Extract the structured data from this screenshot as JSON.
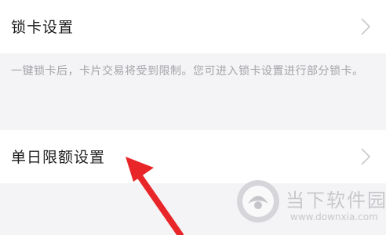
{
  "lock_card": {
    "label": "锁卡设置",
    "description": "一键锁卡后，卡片交易将受到限制。您可进入锁卡设置进行部分锁卡。"
  },
  "single_day_limit": {
    "label": "单日限额设置"
  },
  "watermark": {
    "title": "当下软件园",
    "url": "www.downxia.com"
  },
  "colors": {
    "background": "#f4f4f6",
    "row": "#ffffff",
    "arrow": "#e8262a",
    "description": "#a5a5aa"
  },
  "icons": [
    "chevron-right-icon",
    "red-arrow-annotation",
    "watermark-logo-icon"
  ]
}
